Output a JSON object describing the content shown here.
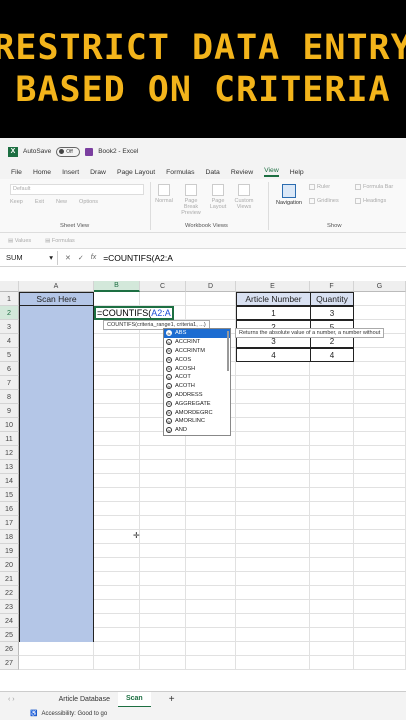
{
  "banner": {
    "line1": "RESTRICT DATA ENTRY",
    "line2": "BASED ON CRITERIA",
    "color": "#f3b41b"
  },
  "titlebar": {
    "autosave": "AutoSave",
    "toggle": "Off",
    "title": "Book2 - Excel"
  },
  "menu": [
    "File",
    "Home",
    "Insert",
    "Draw",
    "Page Layout",
    "Formulas",
    "Data",
    "Review",
    "View",
    "Help"
  ],
  "menu_selected": "View",
  "ribbon": {
    "sheet_view_dropdown": "Default",
    "sheet_view_buttons": [
      "Keep",
      "Exit",
      "New",
      "Options"
    ],
    "sheet_view_group": "Sheet View",
    "workbook_buttons": [
      "Normal",
      "Page Break Preview",
      "Page Layout",
      "Custom Views"
    ],
    "workbook_group": "Workbook Views",
    "navigation": "Navigation",
    "show_items": [
      "Ruler",
      "Formula Bar",
      "Gridlines",
      "Headings"
    ],
    "show_group": "Show"
  },
  "subribbon": [
    "Values",
    "Formulas"
  ],
  "formula_bar": {
    "name_box": "SUM",
    "cancel": "✕",
    "enter": "✓",
    "fx": "fx",
    "formula": "=COUNTIFS(A2:A"
  },
  "columns": [
    "A",
    "B",
    "C",
    "D",
    "E",
    "F",
    "G"
  ],
  "rows": [
    "1",
    "2",
    "3",
    "4",
    "5",
    "6",
    "7",
    "8",
    "9",
    "10",
    "11",
    "12",
    "13",
    "14",
    "15",
    "16",
    "17",
    "18",
    "19",
    "20",
    "21",
    "22",
    "23",
    "24",
    "25",
    "26",
    "27"
  ],
  "scan_header": "Scan Here",
  "edit_cell": {
    "prefix": "=COUNTIFS(",
    "ref": "A2:A"
  },
  "tooltip": "COUNTIFS(criteria_range1, criteria1, ...)",
  "table": {
    "headers": [
      "Article Number",
      "Quantity"
    ],
    "rows": [
      [
        "1",
        "3"
      ],
      [
        "2",
        "5"
      ],
      [
        "3",
        "2"
      ],
      [
        "4",
        "4"
      ]
    ]
  },
  "autocomplete": [
    "ABS",
    "ACCRINT",
    "ACCRINTM",
    "ACOS",
    "ACOSH",
    "ACOT",
    "ACOTH",
    "ADDRESS",
    "AGGREGATE",
    "AMORDEGRC",
    "AMORLINC",
    "AND"
  ],
  "autocomplete_selected": "ABS",
  "autocomplete_desc": "Returns the absolute value of a number, a number without",
  "sheet_tabs": [
    "Article Database",
    "Scan"
  ],
  "active_tab": "Scan",
  "status": "Accessibility: Good to go",
  "colors": {
    "excel_green": "#1d6f42",
    "scan_fill": "#b4c6e7",
    "header_fill": "#d9e1f2",
    "selection": "#1c6cd1"
  }
}
